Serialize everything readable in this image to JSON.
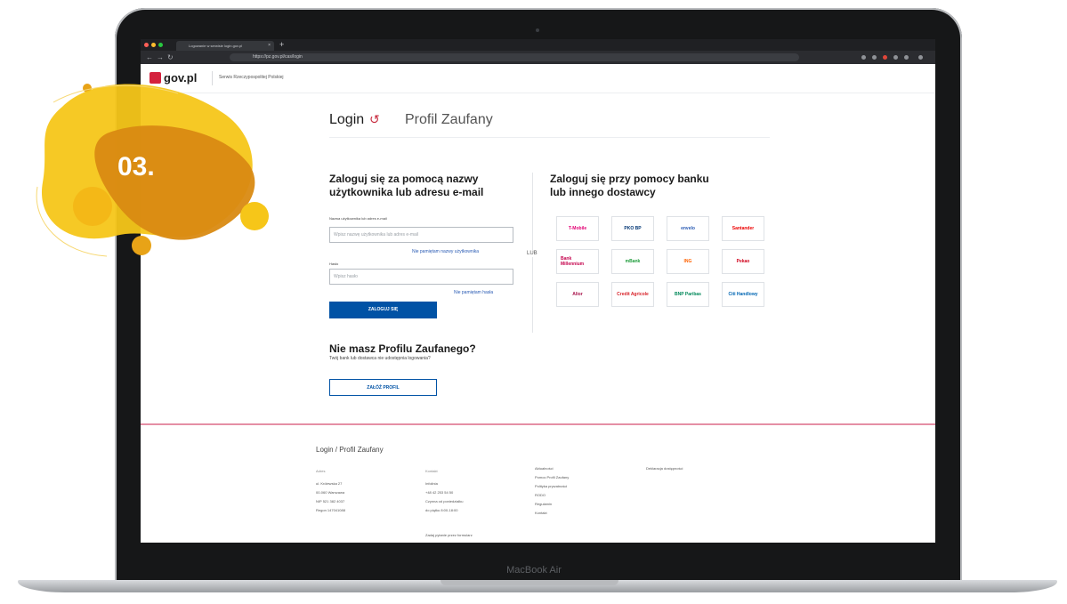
{
  "browser": {
    "tab_title": "Logowanie w serwisie login.gov.pl",
    "tab_close": "×",
    "new_tab": "+",
    "url": "https://pz.gov.pl/cas/login",
    "nav_back": "←",
    "nav_forward": "→",
    "nav_reload": "↻"
  },
  "header": {
    "logo_text": "gov.pl",
    "subtitle": "Serwis Rzeczypospolitej Polskiej"
  },
  "tabs": {
    "login_label": "Login",
    "login_icon": "↺",
    "profil_label": "Profil Zaufany"
  },
  "login_form": {
    "title_line1": "Zaloguj się za pomocą nazwy",
    "title_line2": "użytkownika lub adresu e-mail",
    "username_label": "Nazwa użytkownika lub adres e-mail",
    "username_placeholder": "Wpisz nazwę użytkownika lub adres e-mail",
    "forgot_username": "Nie pamiętam nazwy użytkownika",
    "password_label": "Hasło",
    "password_placeholder": "Wpisz hasło",
    "forgot_password": "Nie pamiętam hasła",
    "submit_label": "ZALOGUJ SIĘ",
    "no_profile_title": "Nie masz Profilu Zaufanego?",
    "no_profile_text": "Twój bank lub dostawca nie udostępnia logowania?",
    "create_profile_label": "ZAŁÓŻ PROFIL"
  },
  "separator": {
    "or_label": "LUB"
  },
  "bank_login": {
    "title_line1": "Zaloguj się przy pomocy banku",
    "title_line2": "lub innego dostawcy",
    "providers": [
      {
        "name": "T-Mobile",
        "color": "#e20074"
      },
      {
        "name": "PKO BP",
        "color": "#003574"
      },
      {
        "name": "envelo",
        "color": "#2a5bb4"
      },
      {
        "name": "Santander",
        "color": "#ec0000"
      },
      {
        "name": "Bank Millennium",
        "color": "#c4004b"
      },
      {
        "name": "mBank",
        "color": "#1d9b3a"
      },
      {
        "name": "ING",
        "color": "#ff6200"
      },
      {
        "name": "Pekao",
        "color": "#d0021b"
      },
      {
        "name": "Alior",
        "color": "#a8124a"
      },
      {
        "name": "Credit Agricole",
        "color": "#d8232a"
      },
      {
        "name": "BNP Paribas",
        "color": "#008859"
      },
      {
        "name": "Citi Handlowy",
        "color": "#0066b3"
      }
    ]
  },
  "footer": {
    "title": "Login / Profil Zaufany",
    "col1_head": "Adres",
    "col1_lines": [
      "ul. Królewska 27",
      "00-060 Warszawa",
      "NIP 521 382 4037",
      "Regon 147041088"
    ],
    "col2_head": "Kontakt",
    "col2_lines": [
      "Infolinia",
      "+48 42 253 54 50",
      "Czynna od poniedziałku",
      "do piątku 8:00-18:00"
    ],
    "col2_extra": "Zadaj pytanie przez formularz",
    "col3_lines": [
      "Aktualności",
      "Pomoc Profil Zaufany",
      "Polityka prywatności",
      "RODO",
      "Regulamin",
      "Kontakt"
    ],
    "col4_lines": [
      "Deklaracja dostępności"
    ]
  },
  "device": {
    "model_label": "MacBook Air"
  },
  "badge": {
    "label": "03.",
    "color_primary": "#f6c619",
    "color_secondary": "#d98a12"
  }
}
